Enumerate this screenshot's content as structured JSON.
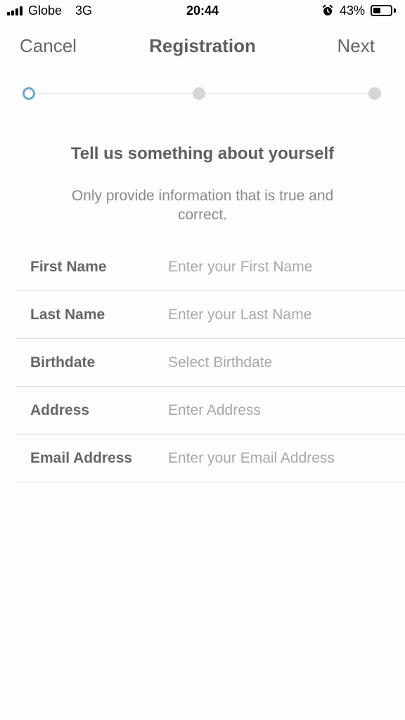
{
  "status_bar": {
    "carrier": "Globe",
    "network": "3G",
    "time": "20:44",
    "battery_percent": "43%",
    "battery_level": 0.43,
    "alarm_icon": "alarm-clock-icon"
  },
  "nav": {
    "cancel_label": "Cancel",
    "title": "Registration",
    "next_label": "Next"
  },
  "stepper": {
    "total_steps": 3,
    "current_step": 1,
    "active_color": "#6fa6cc",
    "inactive_color": "#d6d6d6"
  },
  "intro": {
    "heading": "Tell us something about yourself",
    "subheading": "Only provide information that is true and correct."
  },
  "form": {
    "fields": [
      {
        "label": "First Name",
        "placeholder": "Enter your First Name",
        "value": ""
      },
      {
        "label": "Last Name",
        "placeholder": "Enter your Last Name",
        "value": ""
      },
      {
        "label": "Birthdate",
        "placeholder": "Select Birthdate",
        "value": ""
      },
      {
        "label": "Address",
        "placeholder": "Enter Address",
        "value": ""
      },
      {
        "label": "Email Address",
        "placeholder": "Enter your Email Address",
        "value": ""
      }
    ]
  }
}
